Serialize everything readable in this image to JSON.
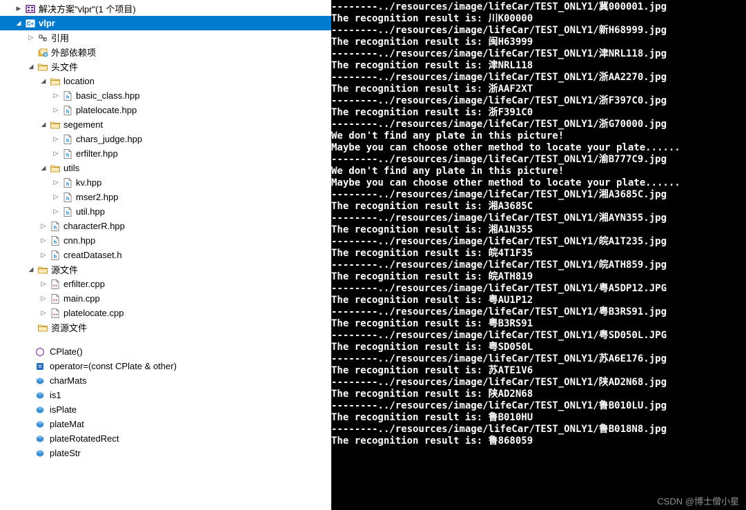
{
  "solution_label": "解决方案\"vlpr\"(1 个项目)",
  "project_name": "vlpr",
  "tree": [
    {
      "level": 0,
      "exp": "▶",
      "icon": "solution",
      "label_key": "solution_label",
      "bold": false,
      "sel": false
    },
    {
      "level": 0,
      "exp": "◢",
      "icon": "project",
      "label_key": "project_name",
      "bold": true,
      "sel": true
    },
    {
      "level": 1,
      "exp": "▷",
      "icon": "ref",
      "label": "引用",
      "bold": false,
      "sel": false
    },
    {
      "level": 1,
      "exp": "",
      "icon": "ext",
      "label": "外部依赖项",
      "bold": false,
      "sel": false
    },
    {
      "level": 1,
      "exp": "◢",
      "icon": "folder",
      "label": "头文件",
      "bold": false,
      "sel": false
    },
    {
      "level": 2,
      "exp": "◢",
      "icon": "folder",
      "label": "location",
      "bold": false,
      "sel": false
    },
    {
      "level": 3,
      "exp": "▷",
      "icon": "hpp",
      "label": "basic_class.hpp",
      "bold": false,
      "sel": false
    },
    {
      "level": 3,
      "exp": "▷",
      "icon": "hpp",
      "label": "platelocate.hpp",
      "bold": false,
      "sel": false
    },
    {
      "level": 2,
      "exp": "◢",
      "icon": "folder",
      "label": "segement",
      "bold": false,
      "sel": false
    },
    {
      "level": 3,
      "exp": "▷",
      "icon": "hpp",
      "label": "chars_judge.hpp",
      "bold": false,
      "sel": false
    },
    {
      "level": 3,
      "exp": "▷",
      "icon": "hpp",
      "label": "erfilter.hpp",
      "bold": false,
      "sel": false
    },
    {
      "level": 2,
      "exp": "◢",
      "icon": "folder",
      "label": "utils",
      "bold": false,
      "sel": false
    },
    {
      "level": 3,
      "exp": "▷",
      "icon": "hpp",
      "label": "kv.hpp",
      "bold": false,
      "sel": false
    },
    {
      "level": 3,
      "exp": "▷",
      "icon": "hpp",
      "label": "mser2.hpp",
      "bold": false,
      "sel": false
    },
    {
      "level": 3,
      "exp": "▷",
      "icon": "hpp",
      "label": "util.hpp",
      "bold": false,
      "sel": false
    },
    {
      "level": 2,
      "exp": "▷",
      "icon": "hpp",
      "label": "characterR.hpp",
      "bold": false,
      "sel": false
    },
    {
      "level": 2,
      "exp": "▷",
      "icon": "hpp",
      "label": "cnn.hpp",
      "bold": false,
      "sel": false
    },
    {
      "level": 2,
      "exp": "▷",
      "icon": "hpp",
      "label": "creatDataset.h",
      "bold": false,
      "sel": false
    },
    {
      "level": 1,
      "exp": "◢",
      "icon": "folder",
      "label": "源文件",
      "bold": false,
      "sel": false
    },
    {
      "level": 2,
      "exp": "▷",
      "icon": "cpp",
      "label": "erfilter.cpp",
      "bold": false,
      "sel": false
    },
    {
      "level": 2,
      "exp": "▷",
      "icon": "cpp",
      "label": "main.cpp",
      "bold": false,
      "sel": false
    },
    {
      "level": 2,
      "exp": "▷",
      "icon": "cpp",
      "label": "platelocate.cpp",
      "bold": false,
      "sel": false
    },
    {
      "level": 1,
      "exp": "",
      "icon": "folder",
      "label": "资源文件",
      "bold": false,
      "sel": false
    }
  ],
  "members": [
    {
      "icon": "method",
      "label": "CPlate()"
    },
    {
      "icon": "operator",
      "label": "operator=(const CPlate & other)"
    },
    {
      "icon": "field",
      "label": "charMats"
    },
    {
      "icon": "field",
      "label": "is1"
    },
    {
      "icon": "field",
      "label": "isPlate"
    },
    {
      "icon": "field",
      "label": "plateMat"
    },
    {
      "icon": "field",
      "label": "plateRotatedRect"
    },
    {
      "icon": "field",
      "label": "plateStr"
    }
  ],
  "console_lines": [
    "--------../resources/image/lifeCar/TEST_ONLY1/冀000001.jpg",
    "The recognition result is: 川K00000",
    "--------../resources/image/lifeCar/TEST_ONLY1/新H68999.jpg",
    "The recognition result is: 闽H63999",
    "--------../resources/image/lifeCar/TEST_ONLY1/津NRL118.jpg",
    "The recognition result is: 津NRL118",
    "--------../resources/image/lifeCar/TEST_ONLY1/浙AA2270.jpg",
    "The recognition result is: 浙AAF2XT",
    "--------../resources/image/lifeCar/TEST_ONLY1/浙F397C0.jpg",
    "The recognition result is: 浙F391C0",
    "--------../resources/image/lifeCar/TEST_ONLY1/浙G70000.jpg",
    "We don't find any plate in this picture!",
    "Maybe you can choose other method to locate your plate......",
    "--------../resources/image/lifeCar/TEST_ONLY1/渝B777C9.jpg",
    "We don't find any plate in this picture!",
    "Maybe you can choose other method to locate your plate......",
    "--------../resources/image/lifeCar/TEST_ONLY1/湘A3685C.jpg",
    "The recognition result is: 湘A3685C",
    "--------../resources/image/lifeCar/TEST_ONLY1/湘AYN355.jpg",
    "The recognition result is: 湘A1N355",
    "--------../resources/image/lifeCar/TEST_ONLY1/皖A1T235.jpg",
    "The recognition result is: 皖4T1F35",
    "--------../resources/image/lifeCar/TEST_ONLY1/皖ATH859.jpg",
    "The recognition result is: 皖ATH819",
    "--------../resources/image/lifeCar/TEST_ONLY1/粤A5DP12.JPG",
    "The recognition result is: 粤AU1P12",
    "--------../resources/image/lifeCar/TEST_ONLY1/粤B3RS91.jpg",
    "The recognition result is: 粤B3RS91",
    "--------../resources/image/lifeCar/TEST_ONLY1/粤SD050L.JPG",
    "The recognition result is: 粤SD050L",
    "--------../resources/image/lifeCar/TEST_ONLY1/苏A6E176.jpg",
    "The recognition result is: 苏ATE1V6",
    "--------../resources/image/lifeCar/TEST_ONLY1/陕AD2N68.jpg",
    "The recognition result is: 陕AD2N68",
    "--------../resources/image/lifeCar/TEST_ONLY1/鲁B010LU.jpg",
    "The recognition result is: 鲁B010HU",
    "--------../resources/image/lifeCar/TEST_ONLY1/鲁B018N8.jpg",
    "The recognition result is: 鲁868059"
  ],
  "watermark": "CSDN @博士僧小星"
}
